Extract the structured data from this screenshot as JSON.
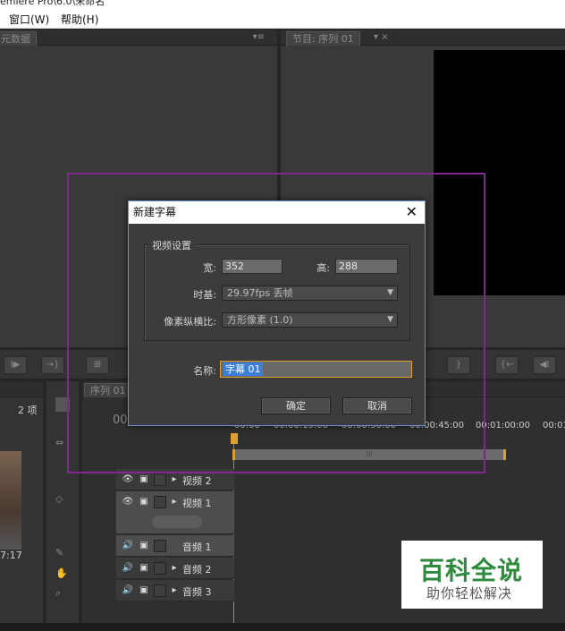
{
  "window": {
    "title": "emiere Pro\\6.0\\未命名"
  },
  "menu": {
    "window": "窗口(W)",
    "help": "帮助(H)"
  },
  "source_panel": {
    "tab": "元数据"
  },
  "program_panel": {
    "tab": "节目: 序列 01"
  },
  "project_panel": {
    "items_count": "2 项",
    "clip_duration": "7:17"
  },
  "timeline": {
    "tab": "序列 01",
    "timecode": "00",
    "ruler": [
      "00:00",
      "00:00:15:00",
      "00:00:30:00",
      "00:00:45:00",
      "00:01:00:00",
      "00:01"
    ],
    "work_area_marker": "III",
    "tracks": [
      {
        "label": "视频 2",
        "kind": "video"
      },
      {
        "label": "视频 1",
        "kind": "video"
      },
      {
        "label": "音频 1",
        "kind": "audio"
      },
      {
        "label": "音频 2",
        "kind": "audio"
      },
      {
        "label": "音频 3",
        "kind": "audio"
      }
    ]
  },
  "dialog": {
    "title": "新建字幕",
    "close_icon": "close-icon",
    "group_title": "视频设置",
    "width_label": "宽:",
    "width_value": "352",
    "height_label": "高:",
    "height_value": "288",
    "timebase_label": "时基:",
    "timebase_value": "29.97fps 丢帧",
    "pixel_aspect_label": "像素纵横比:",
    "pixel_aspect_value": "方形像素 (1.0)",
    "name_label": "名称:",
    "name_value": "字幕 01",
    "ok": "确定",
    "cancel": "取消"
  },
  "watermark": {
    "brand": "百科全说",
    "slogan": "助你轻松解决"
  },
  "colors": {
    "highlight_frame": "#7d2a8a",
    "selection": "#3d7fd6",
    "playhead": "#e07a20",
    "brand_green": "#2e8a3c"
  }
}
